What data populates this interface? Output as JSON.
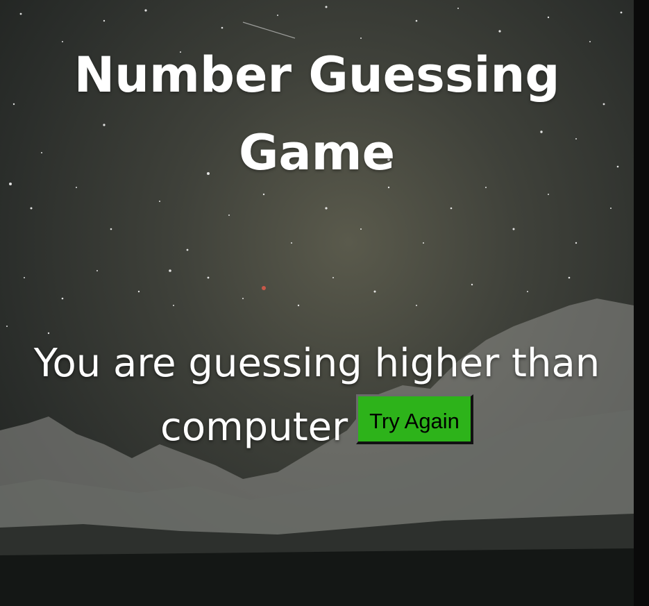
{
  "game": {
    "title_line1": "Number Guessing",
    "title_line2": "Game",
    "message_line1": "You are guessing higher than",
    "message_line2": "computer",
    "try_again_label": "Try Again"
  },
  "colors": {
    "title_text": "#ffffff",
    "button_background": "#2db31a",
    "button_text": "#000000"
  }
}
